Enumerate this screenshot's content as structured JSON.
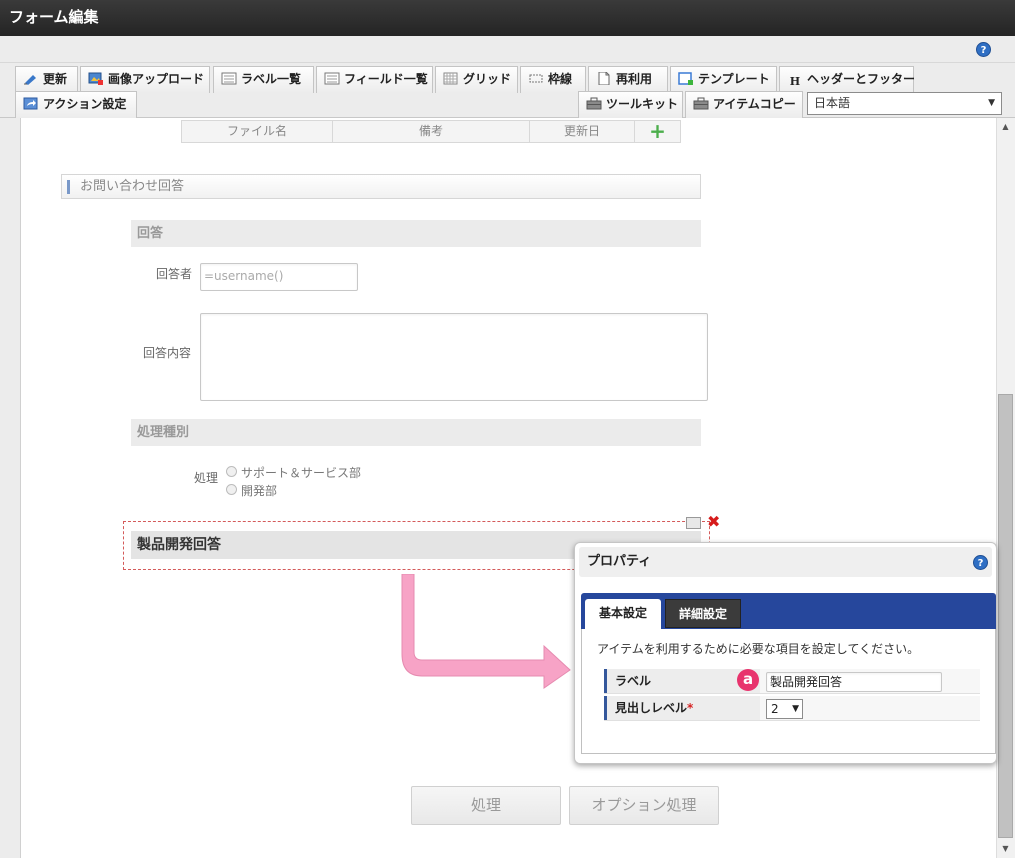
{
  "window": {
    "title": "フォーム編集"
  },
  "toolbar": {
    "row1": [
      {
        "key": "update",
        "label": "更新",
        "icon": "pencil-icon"
      },
      {
        "key": "image-upload",
        "label": "画像アップロード",
        "icon": "image-upload-icon"
      },
      {
        "key": "label-list",
        "label": "ラベル一覧",
        "icon": "list-icon"
      },
      {
        "key": "field-list",
        "label": "フィールド一覧",
        "icon": "list-icon"
      },
      {
        "key": "grid",
        "label": "グリッド",
        "icon": "grid-icon"
      },
      {
        "key": "border",
        "label": "枠線",
        "icon": "border-icon"
      },
      {
        "key": "reuse",
        "label": "再利用",
        "icon": "document-icon"
      },
      {
        "key": "template",
        "label": "テンプレート",
        "icon": "template-icon"
      },
      {
        "key": "header-footer",
        "label": "ヘッダーとフッター",
        "icon": "heading-icon"
      }
    ],
    "row2_left": {
      "label": "アクション設定",
      "icon": "share-icon"
    },
    "row2_right": [
      {
        "key": "toolkit",
        "label": "ツールキット",
        "icon": "toolbox-icon"
      },
      {
        "key": "item-copy",
        "label": "アイテムコピー",
        "icon": "toolbox-icon"
      }
    ],
    "language": {
      "selected": "日本語"
    }
  },
  "form": {
    "file_table_headers": [
      "ファイル名",
      "備考",
      "更新日"
    ],
    "section_title": "お問い合わせ回答",
    "subsection_answer": "回答",
    "responder_label": "回答者",
    "responder_value": "=username()",
    "answer_content_label": "回答内容",
    "subsection_process_type": "処理種別",
    "process_label": "処理",
    "process_options": [
      "サポート＆サービス部",
      "開発部"
    ],
    "selected_heading": "製品開発回答",
    "buttons": {
      "process": "処理",
      "option_process": "オプション処理"
    }
  },
  "properties": {
    "title": "プロパティ",
    "tabs": {
      "basic": "基本設定",
      "detail": "詳細設定"
    },
    "description": "アイテムを利用するために必要な項目を設定してください。",
    "label_field": {
      "label": "ラベル",
      "value": "製品開発回答"
    },
    "heading_level_field": {
      "label": "見出しレベル",
      "required_mark": "*",
      "value": "2"
    },
    "callout": "a"
  },
  "colors": {
    "accent_blue": "#26479c",
    "callout_pink": "#e8336d",
    "arrow_pink": "#f7a3c6"
  }
}
